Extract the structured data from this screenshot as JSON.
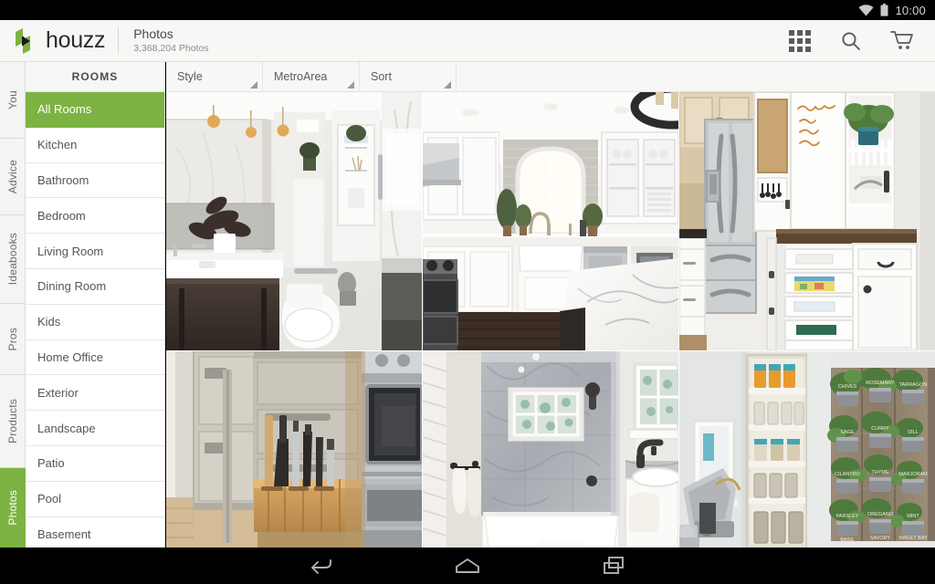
{
  "status_bar": {
    "time": "10:00",
    "icons": [
      "wifi-icon",
      "battery-icon"
    ]
  },
  "app_bar": {
    "logo_text": "houzz",
    "title": "Photos",
    "subtitle": "3,368,204 Photos",
    "actions": [
      {
        "name": "grid-view-icon",
        "label": "Grid view"
      },
      {
        "name": "search-icon",
        "label": "Search"
      },
      {
        "name": "cart-icon",
        "label": "Cart"
      }
    ]
  },
  "rail": {
    "items": [
      {
        "label": "You",
        "active": false
      },
      {
        "label": "Advice",
        "active": false
      },
      {
        "label": "Ideabooks",
        "active": false
      },
      {
        "label": "Pros",
        "active": false
      },
      {
        "label": "Products",
        "active": false
      },
      {
        "label": "Photos",
        "active": true
      }
    ]
  },
  "rooms_panel": {
    "header": "ROOMS",
    "items": [
      {
        "label": "All Rooms",
        "selected": true
      },
      {
        "label": "Kitchen",
        "selected": false
      },
      {
        "label": "Bathroom",
        "selected": false
      },
      {
        "label": "Bedroom",
        "selected": false
      },
      {
        "label": "Living Room",
        "selected": false
      },
      {
        "label": "Dining Room",
        "selected": false
      },
      {
        "label": "Kids",
        "selected": false
      },
      {
        "label": "Home Office",
        "selected": false
      },
      {
        "label": "Exterior",
        "selected": false
      },
      {
        "label": "Landscape",
        "selected": false
      },
      {
        "label": "Patio",
        "selected": false
      },
      {
        "label": "Pool",
        "selected": false
      },
      {
        "label": "Basement",
        "selected": false
      }
    ]
  },
  "filter_bar": {
    "filters": [
      {
        "label": "Style"
      },
      {
        "label": "MetroArea"
      },
      {
        "label": "Sort"
      }
    ]
  },
  "photo_grid": {
    "photos": [
      {
        "id": "photo-1",
        "description": "White marble bathroom with dark vanity, pendant lights and glass shower"
      },
      {
        "id": "photo-2",
        "description": "White kitchen with arched window, farmhouse sink and marble island"
      },
      {
        "id": "photo-3",
        "description": "Kitchen command center with stainless refrigerator, cork board and file organizer"
      },
      {
        "id": "photo-4",
        "description": "Pull-out wooden knife block drawer beside stainless steel oven"
      },
      {
        "id": "photo-5",
        "description": "Gray marble bathroom with tub shower, window and towel bar"
      },
      {
        "id": "photo-6",
        "description": "Kitchen pantry with stand mixer and vertical herb garden wall"
      }
    ]
  },
  "nav_bar": {
    "buttons": [
      {
        "name": "back-button",
        "label": "Back"
      },
      {
        "name": "home-button",
        "label": "Home"
      },
      {
        "name": "recents-button",
        "label": "Recent apps"
      }
    ]
  },
  "colors": {
    "accent_green": "#7cb342",
    "appbar_bg": "#f7f7f5",
    "text_primary": "#4a4a4a",
    "text_secondary": "#8d8d8d"
  }
}
